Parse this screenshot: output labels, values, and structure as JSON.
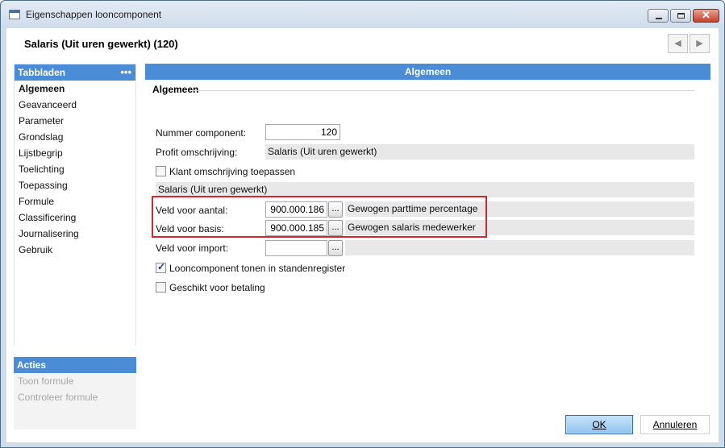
{
  "window": {
    "title": "Eigenschappen looncomponent"
  },
  "header": {
    "title": "Salaris (Uit uren gewerkt) (120)",
    "prev_icon": "chevron-left-icon",
    "next_icon": "chevron-right-icon",
    "prev_glyph": "◀",
    "next_glyph": "▶"
  },
  "sidebar": {
    "title": "Tabbladen",
    "more_glyph": "•••",
    "items": [
      {
        "label": "Algemeen"
      },
      {
        "label": "Geavanceerd"
      },
      {
        "label": "Parameter"
      },
      {
        "label": "Grondslag"
      },
      {
        "label": "Lijstbegrip"
      },
      {
        "label": "Toelichting"
      },
      {
        "label": "Toepassing"
      },
      {
        "label": "Formule"
      },
      {
        "label": "Classificering"
      },
      {
        "label": "Journalisering"
      },
      {
        "label": "Gebruik"
      }
    ],
    "active_index": 0
  },
  "actions": {
    "title": "Acties",
    "items": [
      {
        "label": "Toon formule"
      },
      {
        "label": "Controleer formule"
      }
    ]
  },
  "main": {
    "header": "Algemeen",
    "section": "Algemeen",
    "fields": {
      "nummer_label": "Nummer component:",
      "nummer_value": "120",
      "profit_label": "Profit omschrijving:",
      "profit_value": "Salaris (Uit uren gewerkt)",
      "klant_label": "Klant omschrijving toepassen",
      "klant_checked": false,
      "klant_value": "Salaris (Uit uren gewerkt)",
      "aantal_label": "Veld voor aantal:",
      "aantal_value": "900.000.186",
      "aantal_desc": "Gewogen parttime percentage",
      "basis_label": "Veld voor basis:",
      "basis_value": "900.000.185",
      "basis_desc": "Gewogen salaris medewerker",
      "import_label": "Veld voor import:",
      "import_value": "",
      "import_desc": "",
      "tonen_label": "Looncomponent tonen in standenregister",
      "tonen_checked": true,
      "betaling_label": "Geschikt voor betaling",
      "betaling_checked": false,
      "lookup_glyph": "..."
    }
  },
  "buttons": {
    "ok_label": "OK",
    "cancel_label": "Annuleren"
  },
  "colors": {
    "accent": "#4a8cd6",
    "highlight": "#d8262d"
  }
}
